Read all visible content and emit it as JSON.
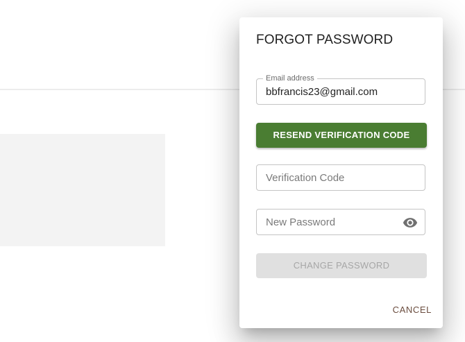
{
  "dialog": {
    "title": "FORGOT PASSWORD",
    "email_field": {
      "label": "Email address",
      "value": "bbfrancis23@gmail.com"
    },
    "resend_button_label": "RESEND VERIFICATION CODE",
    "verification_code_field": {
      "placeholder": "Verification Code"
    },
    "new_password_field": {
      "placeholder": "New Password",
      "toggle_icon": "eye-icon"
    },
    "change_password_button_label": "CHANGE PASSWORD",
    "cancel_button_label": "CANCEL"
  },
  "colors": {
    "primary_green": "#4a7d32",
    "cancel_text": "#6b4d3f",
    "disabled_bg": "#e0e0e0",
    "disabled_text": "#a6a6a6"
  }
}
